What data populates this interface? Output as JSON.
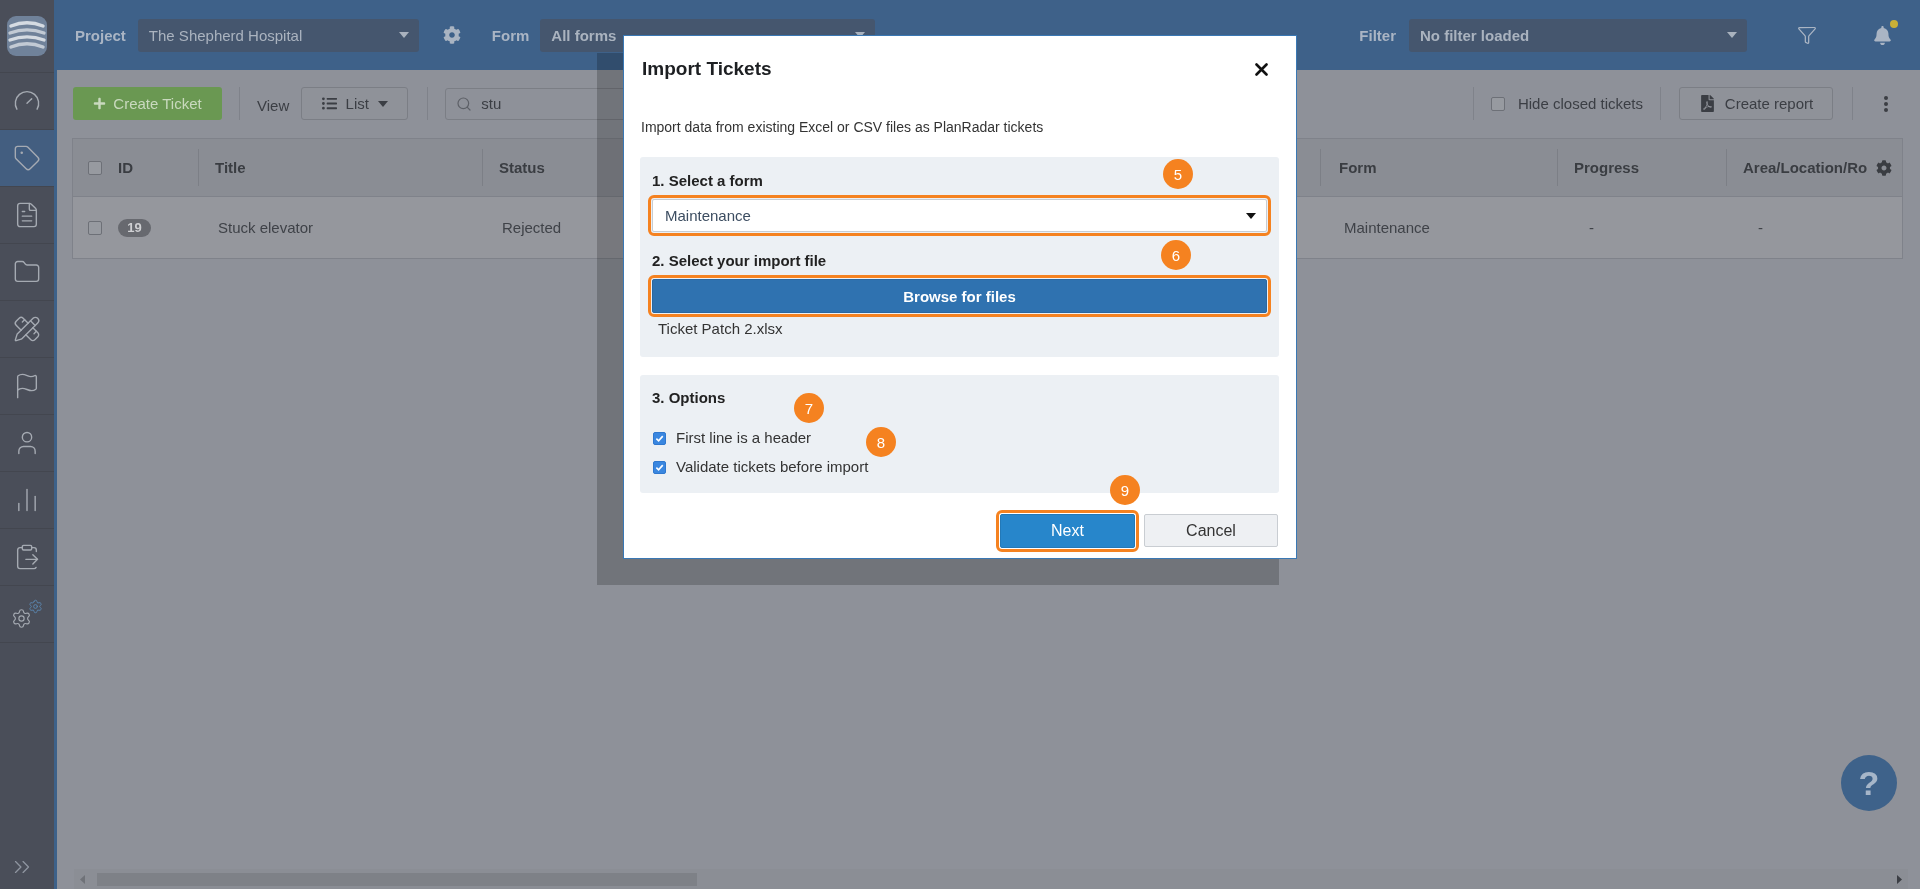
{
  "sidebar": {
    "items": [
      {
        "selected": false
      },
      {
        "selected": true
      },
      {
        "selected": false
      },
      {
        "selected": false
      },
      {
        "selected": false
      },
      {
        "selected": false
      },
      {
        "selected": false
      },
      {
        "selected": false
      },
      {
        "selected": false
      },
      {
        "selected": false
      }
    ]
  },
  "top_bar": {
    "project_label": "Project",
    "project": "The Shepherd Hospital",
    "form_label": "Form",
    "form": "All forms",
    "filter_label": "Filter",
    "filter": "No filter loaded",
    "has_notification": true
  },
  "toolbar": {
    "create_button": "Create Ticket",
    "view_label": "View",
    "view": "List",
    "search": "stu",
    "hide_closed": {
      "label": "Hide closed tickets",
      "checked": false
    },
    "report_button": "Create report"
  },
  "table": {
    "all_checked": false,
    "columns": [
      "ID",
      "Title",
      "Status",
      "Form",
      "Progress",
      "Area/Location/Ro"
    ],
    "rows": [
      {
        "checked": false,
        "cells": [
          "19",
          "Stuck elevator",
          "Rejected",
          "Maintenance",
          "-",
          "-"
        ]
      }
    ]
  },
  "dialog": {
    "title": "Import Tickets",
    "description": "Import data from existing Excel or CSV files as PlanRadar tickets",
    "form_step": {
      "heading": "1. Select a form",
      "value": "Maintenance",
      "highlighted": true,
      "marker": "5"
    },
    "file_step": {
      "heading": "2. Select your import file",
      "button": "Browse for files",
      "highlighted": true,
      "marker": "6",
      "file_name": "Ticket Patch 2.xlsx"
    },
    "options_step": {
      "heading": "3. Options",
      "options": [
        {
          "label": "First line is a header",
          "checked": true,
          "marker": "7"
        },
        {
          "label": "Validate tickets before import",
          "checked": true,
          "marker": "8"
        }
      ]
    },
    "buttons": [
      {
        "label": "Next",
        "kind": "primary",
        "highlighted": true,
        "marker": "9"
      },
      {
        "label": "Cancel",
        "kind": "secondary",
        "highlighted": false
      }
    ]
  },
  "help_button": {
    "label": "?"
  }
}
